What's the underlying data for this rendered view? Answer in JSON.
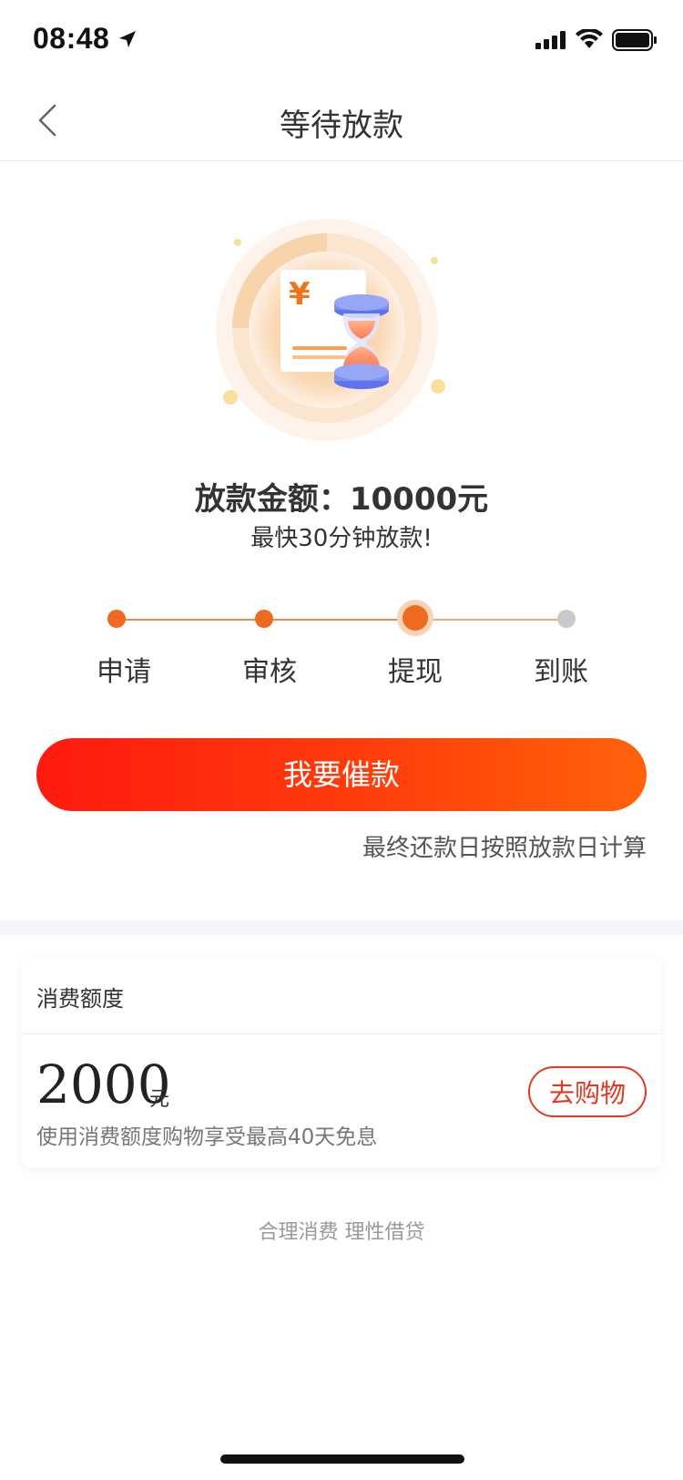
{
  "status_bar": {
    "time": "08:48",
    "icons": [
      "location-arrow-icon",
      "cellular-signal-icon",
      "wifi-icon",
      "battery-icon"
    ]
  },
  "nav": {
    "title": "等待放款",
    "back_icon": "chevron-left-icon"
  },
  "hero": {
    "illustration": "hourglass-document-icon",
    "currency_symbol": "¥"
  },
  "loan": {
    "amount_text": "放款金额：10000元",
    "subtitle": "最快30分钟放款!"
  },
  "steps": [
    {
      "label": "申请",
      "state": "done"
    },
    {
      "label": "审核",
      "state": "done"
    },
    {
      "label": "提现",
      "state": "current"
    },
    {
      "label": "到账",
      "state": "pending"
    }
  ],
  "actions": {
    "urge_label": "我要催款",
    "repay_note": "最终还款日按照放款日计算"
  },
  "credit": {
    "title": "消费额度",
    "amount": "2000",
    "unit": "元",
    "description": "使用消费额度购物享受最高40天免息",
    "shop_label": "去购物"
  },
  "footer": {
    "slogan": "合理消费 理性借贷"
  },
  "colors": {
    "accent_orange": "#ee6a1e",
    "button_gradient_start": "#ff1a10",
    "button_gradient_end": "#ff620a",
    "shop_red": "#e23a22",
    "pending_gray": "#c9c9c9"
  }
}
